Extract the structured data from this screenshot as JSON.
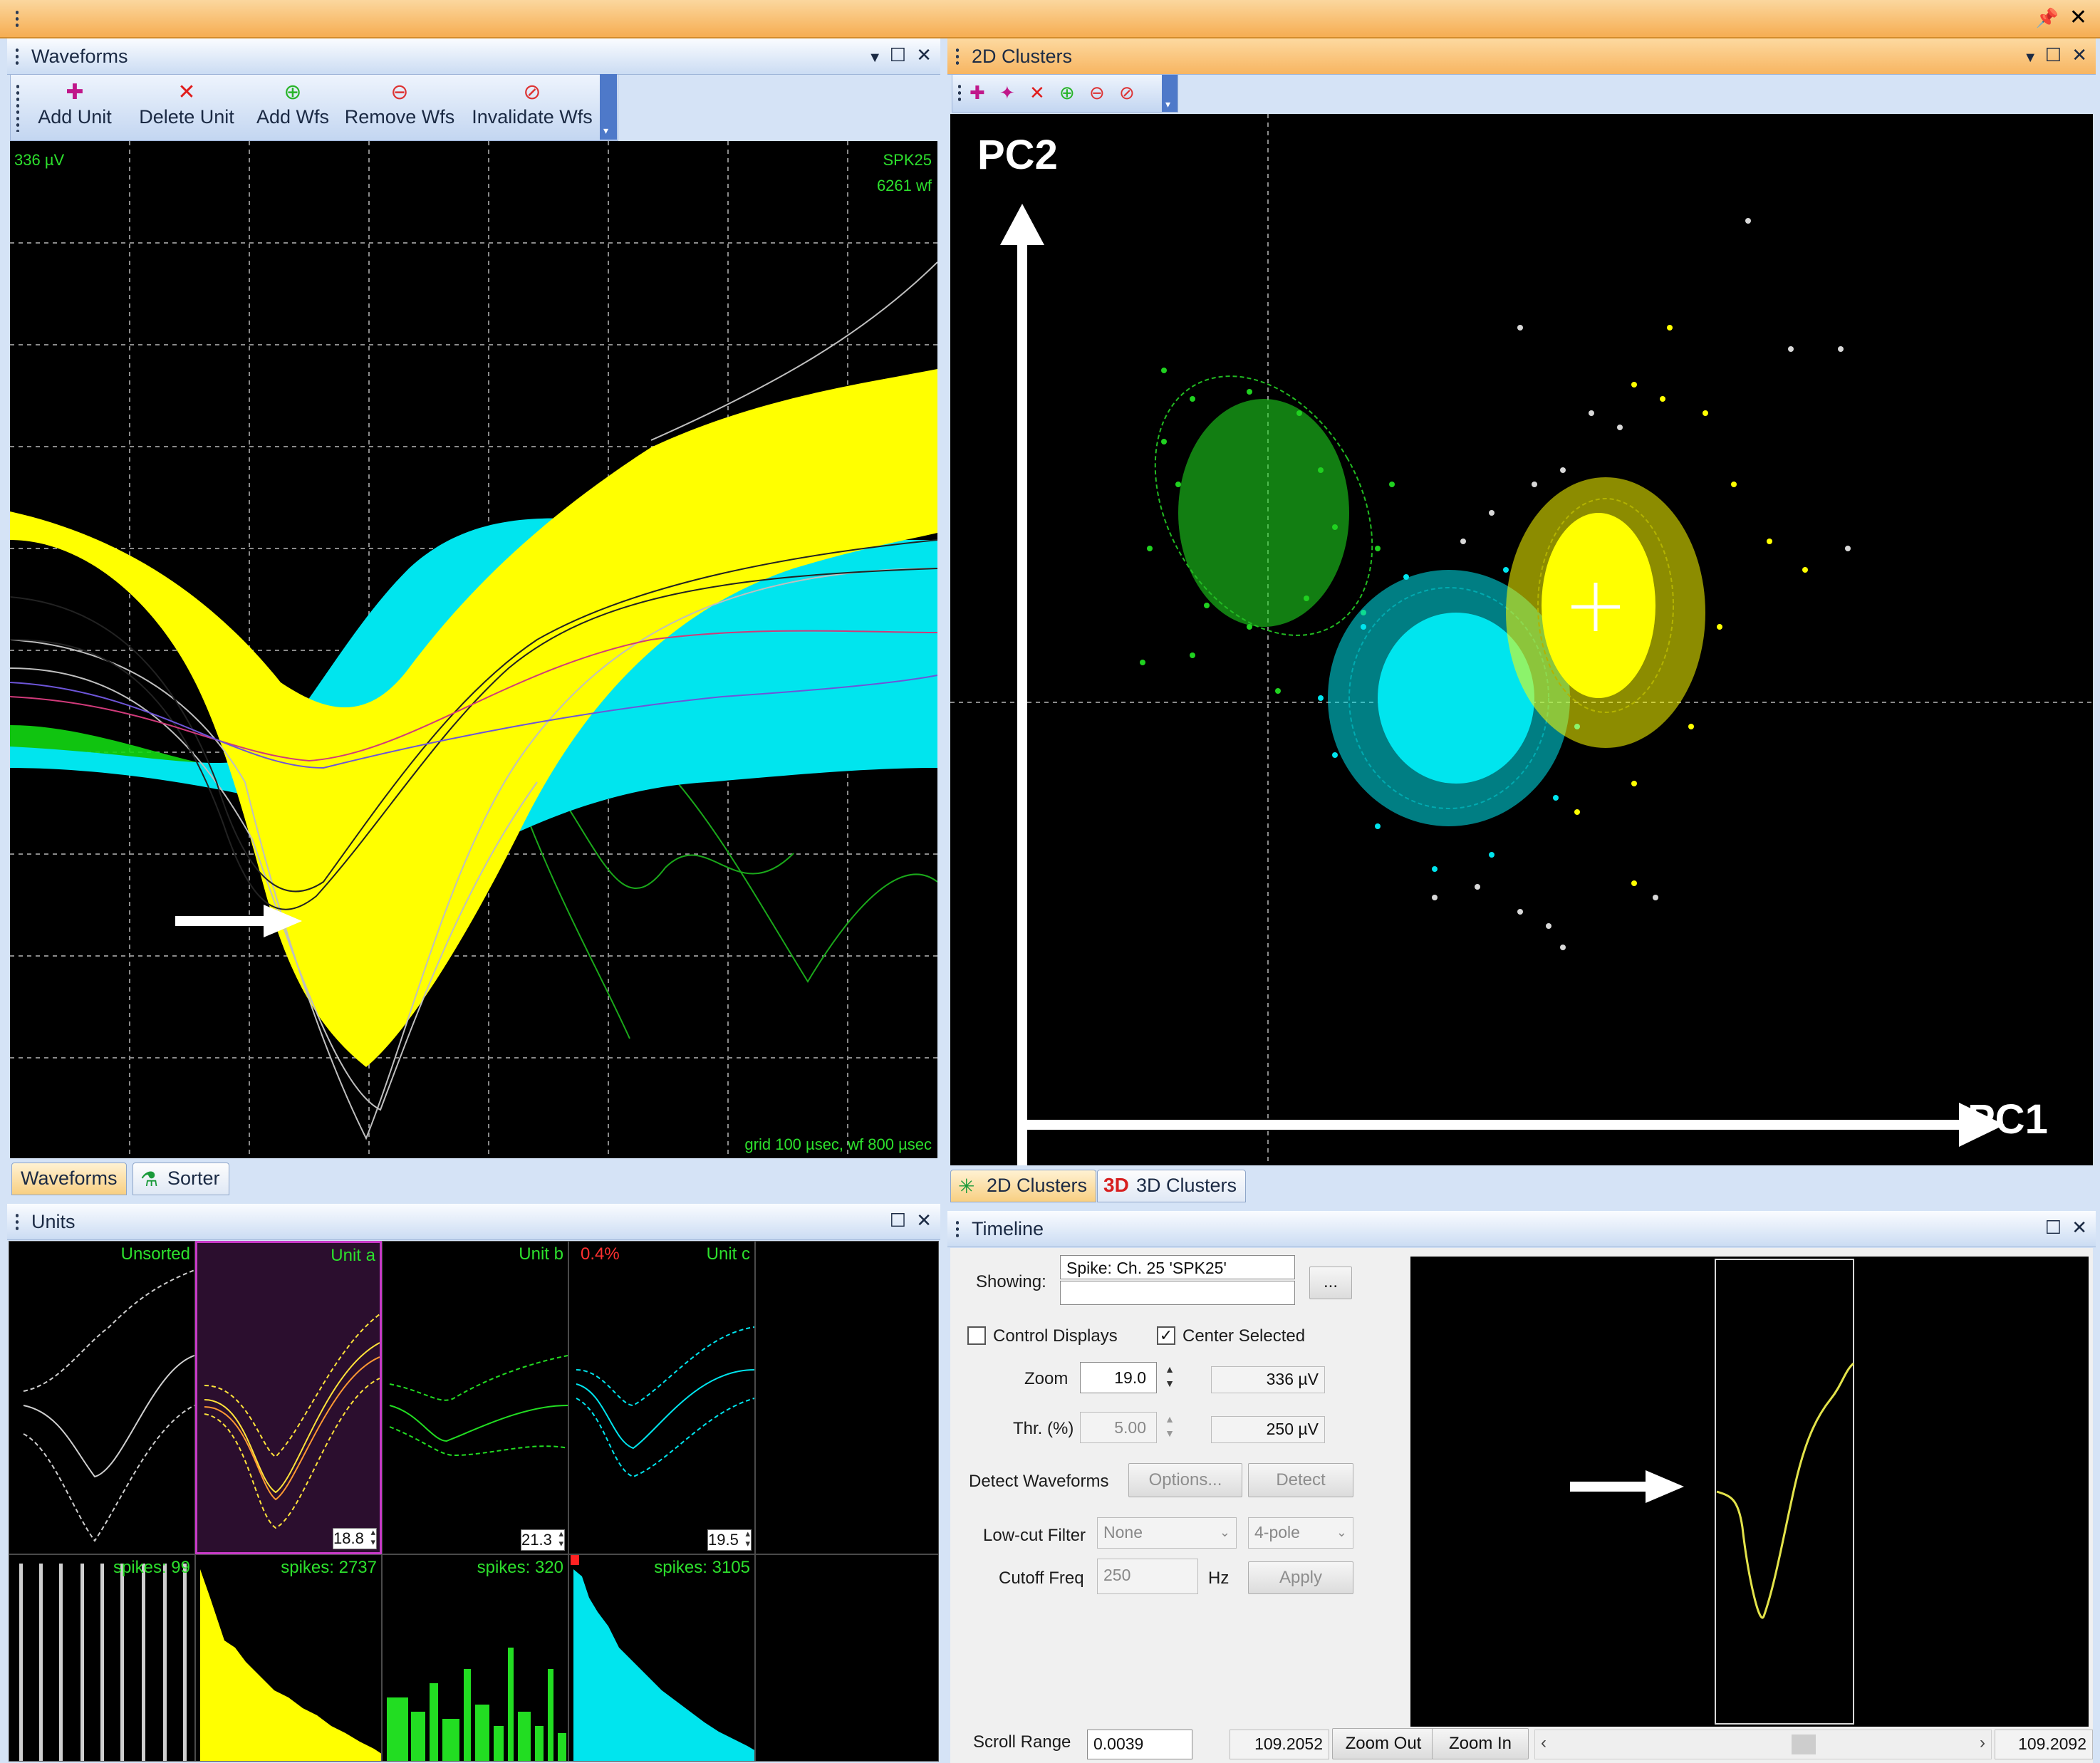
{
  "colors": {
    "unit_a": "#ffff00",
    "unit_b": "#22dd22",
    "unit_c": "#00e5ee",
    "unsorted": "#cfcfcf",
    "active_title": "#f7b561"
  },
  "waveforms_panel": {
    "title": "Waveforms",
    "toolbar": [
      "Add Unit",
      "Delete Unit",
      "Add Wfs",
      "Remove Wfs",
      "Invalidate Wfs"
    ],
    "scale_label": "336 µV",
    "channel_label": "SPK25",
    "wf_count": "6261 wf",
    "grid_label": "grid 100 µsec, wf 800 µsec",
    "tabs": [
      "Waveforms",
      "Sorter"
    ]
  },
  "clusters_panel": {
    "title": "2D Clusters",
    "axis_y": "PC2",
    "axis_x": "PC1",
    "tabs": [
      "2D Clusters",
      "3D Clusters"
    ],
    "tab_3d_badge": "3D"
  },
  "units_panel": {
    "title": "Units",
    "units": [
      {
        "name": "Unsorted",
        "spin": "",
        "spikes": "spikes: 99"
      },
      {
        "name": "Unit a",
        "spin": "18.8",
        "spikes": "spikes: 2737"
      },
      {
        "name": "Unit b",
        "spin": "21.3",
        "spikes": "spikes: 320"
      },
      {
        "name": "Unit c",
        "spin": "19.5",
        "spikes": "spikes: 3105",
        "pct": "0.4%"
      }
    ]
  },
  "timeline_panel": {
    "title": "Timeline",
    "showing_label": "Showing:",
    "showing_value": "Spike: Ch. 25 'SPK25'",
    "browse_label": "...",
    "control_displays": "Control Displays",
    "center_selected": "Center Selected",
    "zoom_label": "Zoom",
    "zoom_value": "19.0",
    "zoom_readout": "336 µV",
    "thr_label": "Thr. (%)",
    "thr_value": "5.00",
    "thr_readout": "250 µV",
    "detect_label": "Detect Waveforms",
    "options_btn": "Options...",
    "detect_btn": "Detect",
    "lowcut_label": "Low-cut Filter",
    "lowcut_value": "None",
    "pole_value": "4-pole",
    "cutoff_label": "Cutoff Freq",
    "cutoff_value": "250",
    "cutoff_unit": "Hz",
    "apply_btn": "Apply",
    "scroll_label": "Scroll Range",
    "scroll_value": "0.0039",
    "time_start": "109.2052",
    "zoom_out": "Zoom Out",
    "zoom_in": "Zoom In",
    "time_end": "109.2092"
  }
}
